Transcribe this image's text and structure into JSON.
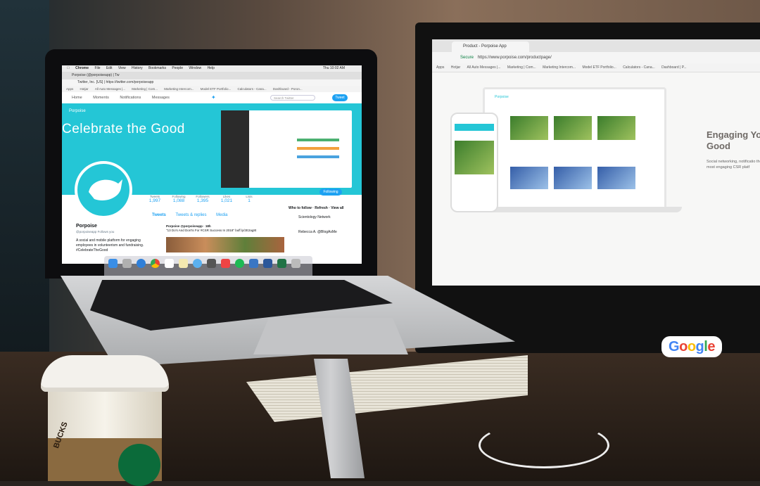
{
  "monitor": {
    "tab_title": "Product - Porpoise App",
    "url_secure": "Secure",
    "url": "https://www.porpoise.com/productpage/",
    "bookmarks": [
      "Apps",
      "Hotjar",
      "All Auto Messages |...",
      "Marketing | Com...",
      "Marketing Intercom...",
      "Model ETF Portfolio...",
      "Calculators - Cana...",
      "Dashboard | P..."
    ],
    "site_brand": "Porpoise",
    "heading": "Engaging Yo Good",
    "subtext": "Social networking, notificatio the most engaging CSR platf"
  },
  "laptop": {
    "menubar": [
      "Chrome",
      "File",
      "Edit",
      "View",
      "History",
      "Bookmarks",
      "People",
      "Window",
      "Help"
    ],
    "clock": "Thu 10:02 AM",
    "tab_title": "Porpoise (@porpoiseapp) | Tw",
    "url": "Twitter, Inc. [US] | https://twitter.com/porpoiseapp",
    "bookmarks": [
      "Apps",
      "Hotjar",
      "All Auto Messages |...",
      "Marketing | Com...",
      "Marketing Intercom...",
      "Model ETF Portfolio...",
      "Calculators - Cana...",
      "Dashboard - Poron..."
    ],
    "nav": [
      "Home",
      "Moments",
      "Notifications",
      "Messages"
    ],
    "search_placeholder": "Search Twitter",
    "tweet_button": "Tweet",
    "header_brand": "Porpoise",
    "header_title": "Celebrate the Good",
    "stats": [
      {
        "label": "Tweets",
        "value": "1,997"
      },
      {
        "label": "Following",
        "value": "1,088"
      },
      {
        "label": "Followers",
        "value": "1,395"
      },
      {
        "label": "Likes",
        "value": "1,021"
      },
      {
        "label": "Lists",
        "value": "1"
      }
    ],
    "follow_button": "Following",
    "profile_name": "Porpoise",
    "profile_handle": "@porpoiseapp  Follows you",
    "profile_bio": "A social and mobile platform for engaging employees in volunteerism and fundraising. #CelebrateTheGood",
    "tabs": [
      "Tweets",
      "Tweets & replies",
      "Media"
    ],
    "tweet_author": "Porpoise @porpoiseapp · 18h",
    "tweet_text": "\"13 Do's And Don'ts For #CSR Success In 2018\" buff.ly/2E2ag8t",
    "who_to_follow": "Who to follow · Refresh · View all",
    "who_1": "Scientology Network",
    "who_2": "Rebecca A. @BlogAsMe"
  },
  "sticker": [
    "G",
    "o",
    "o",
    "g",
    "l",
    "e"
  ],
  "cup_text": "BUCKS"
}
